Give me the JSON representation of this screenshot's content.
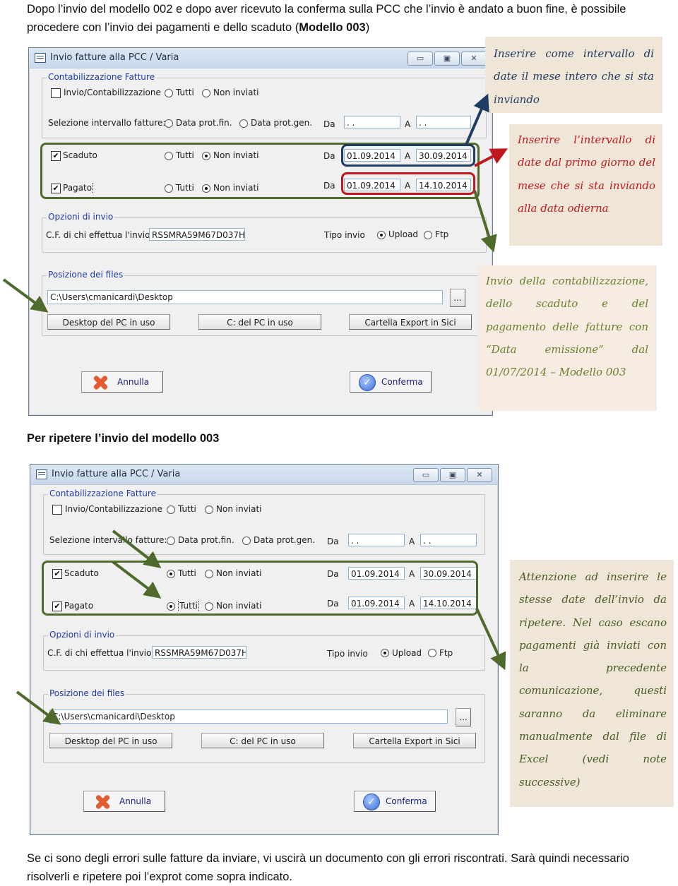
{
  "intro_text_1": "Dopo l’invio del modello 002 e dopo aver ricevuto la conferma sulla PCC che l’invio è andato a buon fine, è possibile procedere con l’invio dei pagamenti e dello scaduto (",
  "intro_text_bold": "Modello 003",
  "intro_text_2": ")",
  "section_heading": "Per ripetere l’invio del modello 003",
  "outro_text": "Se ci sono degli errori sulle fatture da inviare, vi uscirà un documento con gli errori riscontrati. Sarà quindi necessario risolverli e ripetere poi l’exprot come sopra indicato.",
  "dialogs": [
    {
      "title": "Invio fatture alla PCC / Varia",
      "window_buttons": {
        "minimize": "▭",
        "maximize": "▣",
        "close": "✕"
      },
      "group_contab": {
        "label": "Contabilizzazione Fatture",
        "checkbox_label": "Invio/Contabilizzazione",
        "checked": false,
        "radio_tutti": "Tutti",
        "radio_non_inviati": "Non inviati",
        "selection_label": "Selezione intervallo fatture:",
        "radio_prot_fin": "Data prot.fin.",
        "radio_prot_gen": "Data prot.gen.",
        "da_label": "Da",
        "a_label": "A",
        "da_value": " . .",
        "a_value": " . ."
      },
      "scaduto": {
        "label": "Scaduto",
        "checked": true,
        "tutti": "Tutti",
        "non_inviati": "Non inviati",
        "selected": "non_inviati",
        "da_label": "Da",
        "a_label": "A",
        "da_value": "01.09.2014",
        "a_value": "30.09.2014"
      },
      "pagato": {
        "label": "Pagato",
        "checked": true,
        "tutti": "Tutti",
        "non_inviati": "Non inviati",
        "selected": "non_inviati",
        "da_label": "Da",
        "a_label": "A",
        "da_value": "01.09.2014",
        "a_value": "14.10.2014"
      },
      "opzioni": {
        "label": "Opzioni di invio",
        "cf_label": "C.F. di chi effettua l'invio",
        "cf_value": "RSSMRA59M67D037H",
        "tipo_label": "Tipo invio",
        "upload": "Upload",
        "ftp": "Ftp",
        "selected": "upload"
      },
      "files": {
        "label": "Posizione dei files",
        "path_value": "C:\\Users\\cmanicardi\\Desktop",
        "browse": "...",
        "btn_desktop": "Desktop del PC in uso",
        "btn_c": "C: del PC in uso",
        "btn_export": "Cartella Export in Sici"
      },
      "annulla": "Annulla",
      "conferma": "Conferma"
    },
    {
      "title": "Invio fatture alla PCC / Varia",
      "window_buttons": {
        "minimize": "▭",
        "maximize": "▣",
        "close": "✕"
      },
      "group_contab": {
        "label": "Contabilizzazione Fatture",
        "checkbox_label": "Invio/Contabilizzazione",
        "checked": false,
        "radio_tutti": "Tutti",
        "radio_non_inviati": "Non inviati",
        "selection_label": "Selezione intervallo fatture:",
        "radio_prot_fin": "Data prot.fin.",
        "radio_prot_gen": "Data prot.gen.",
        "da_label": "Da",
        "a_label": "A",
        "da_value": " . .",
        "a_value": " . ."
      },
      "scaduto": {
        "label": "Scaduto",
        "checked": true,
        "tutti": "Tutti",
        "non_inviati": "Non inviati",
        "selected": "tutti",
        "da_label": "Da",
        "a_label": "A",
        "da_value": "01.09.2014",
        "a_value": "30.09.2014"
      },
      "pagato": {
        "label": "Pagato",
        "checked": true,
        "tutti": "Tutti",
        "non_inviati": "Non inviati",
        "selected": "tutti",
        "da_label": "Da",
        "a_label": "A",
        "da_value": "01.09.2014",
        "a_value": "14.10.2014"
      },
      "opzioni": {
        "label": "Opzioni di invio",
        "cf_label": "C.F. di chi effettua l'invio",
        "cf_value": "RSSMRA59M67D037H",
        "tipo_label": "Tipo invio",
        "upload": "Upload",
        "ftp": "Ftp",
        "selected": "upload"
      },
      "files": {
        "label": "Posizione dei files",
        "path_value": "C:\\Users\\cmanicardi\\Desktop",
        "browse": "...",
        "btn_desktop": "Desktop del PC in uso",
        "btn_c": "C: del PC in uso",
        "btn_export": "Cartella Export in Sici"
      },
      "annulla": "Annulla",
      "conferma": "Conferma"
    }
  ],
  "notes": {
    "whole_month": {
      "text": "Inserire come intervallo di date il mese intero che si sta inviando",
      "color": "#1f3c63"
    },
    "to_today": {
      "text": "Inserire l’intervallo di date dal primo giorno del mese che si sta inviando alla data odierna",
      "color": "#c0181e"
    },
    "model_003": {
      "text": "Invio della contabilizzazione, dello scaduto e del pagamento delle fatture con “Data emissione” dal 01/07/2014 – Modello 003",
      "color": "#6b7f2e"
    },
    "repeat_warning": {
      "text": "Attenzione ad inserire le stesse date dell’invio da ripetere. Nel caso escano pagamenti già inviati con la precedente comunicazione, questi saranno da eliminare manualmente dal file di Excel (vedi note successive)",
      "color": "#4a5a22"
    }
  },
  "colors": {
    "arrow_green": "#4e6b2c",
    "arrow_blue": "#1f3c63",
    "arrow_red": "#c0181e",
    "note_bg": "#f0e6d8",
    "group_label": "#1f3aa8"
  }
}
